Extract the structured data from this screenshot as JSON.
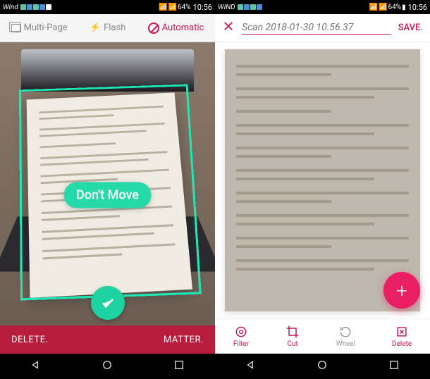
{
  "status": {
    "carrier": "Wind",
    "battery_text": "64%",
    "time_left": "10:56",
    "carrier_right": "WIND",
    "time_right": "10:56"
  },
  "left": {
    "toolbar": {
      "multipage": "Multi-Page",
      "flash": "Flash",
      "automatic": "Automatic"
    },
    "overlay_message": "Don't Move",
    "bottom": {
      "delete": "DELETE.",
      "matter": "MATTER."
    }
  },
  "right": {
    "title": "Scan 2018-01-30 10.56.37",
    "save": "SAVE.",
    "bottom": {
      "filter": "Filter",
      "cut": "Cut",
      "wheel": "Wheel",
      "delete": "Delete"
    },
    "fab_text": "+"
  },
  "colors": {
    "accent_pink": "#c2185b",
    "accent_red": "#b71c3c",
    "accent_teal": "#1dd1a1",
    "fab_pink": "#e91e63",
    "frame_green": "#1de9b6"
  }
}
